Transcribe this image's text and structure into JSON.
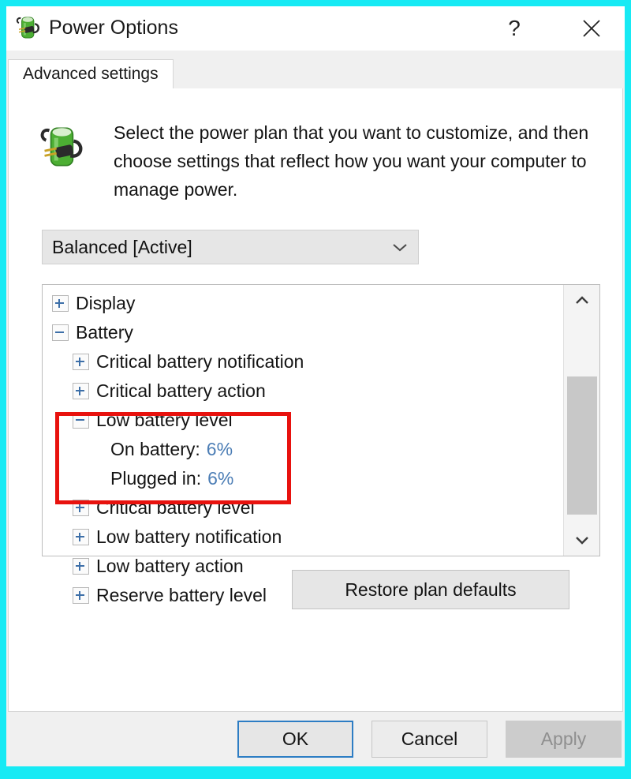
{
  "window": {
    "title": "Power Options",
    "icon": "battery-power-icon",
    "help_label": "?",
    "close_label": "✕",
    "annotation_border_color": "#17eaf4"
  },
  "tabs": [
    {
      "label": "Advanced settings",
      "selected": true
    }
  ],
  "description": {
    "icon": "battery-power-icon",
    "text": "Select the power plan that you want to customize, and then choose settings that reflect how you want your computer to manage power."
  },
  "plan_select": {
    "value": "Balanced [Active]",
    "arrow_icon": "chevron-down-icon"
  },
  "tree": {
    "rows": [
      {
        "level": 0,
        "state": "collapsed",
        "label": "Display"
      },
      {
        "level": 0,
        "state": "expanded",
        "label": "Battery"
      },
      {
        "level": 1,
        "state": "collapsed",
        "label": "Critical battery notification"
      },
      {
        "level": 1,
        "state": "collapsed",
        "label": "Critical battery action"
      },
      {
        "level": 1,
        "state": "expanded",
        "label": "Low battery level"
      },
      {
        "level": 2,
        "state": "none",
        "label": "On battery:",
        "value": "6%"
      },
      {
        "level": 2,
        "state": "none",
        "label": "Plugged in:",
        "value": "6%"
      },
      {
        "level": 1,
        "state": "collapsed",
        "label": "Critical battery level"
      },
      {
        "level": 1,
        "state": "collapsed",
        "label": "Low battery notification"
      },
      {
        "level": 1,
        "state": "collapsed",
        "label": "Low battery action"
      },
      {
        "level": 1,
        "state": "collapsed",
        "label": "Reserve battery level"
      }
    ],
    "highlight_color": "#e8120e",
    "value_color": "#4b7db5",
    "scrollbar": {
      "up_icon": "chevron-up-icon",
      "down_icon": "chevron-down-icon"
    }
  },
  "buttons": {
    "restore": "Restore plan defaults",
    "ok": "OK",
    "cancel": "Cancel",
    "apply": "Apply",
    "apply_enabled": false,
    "ok_focus_color": "#2d7dc4"
  }
}
